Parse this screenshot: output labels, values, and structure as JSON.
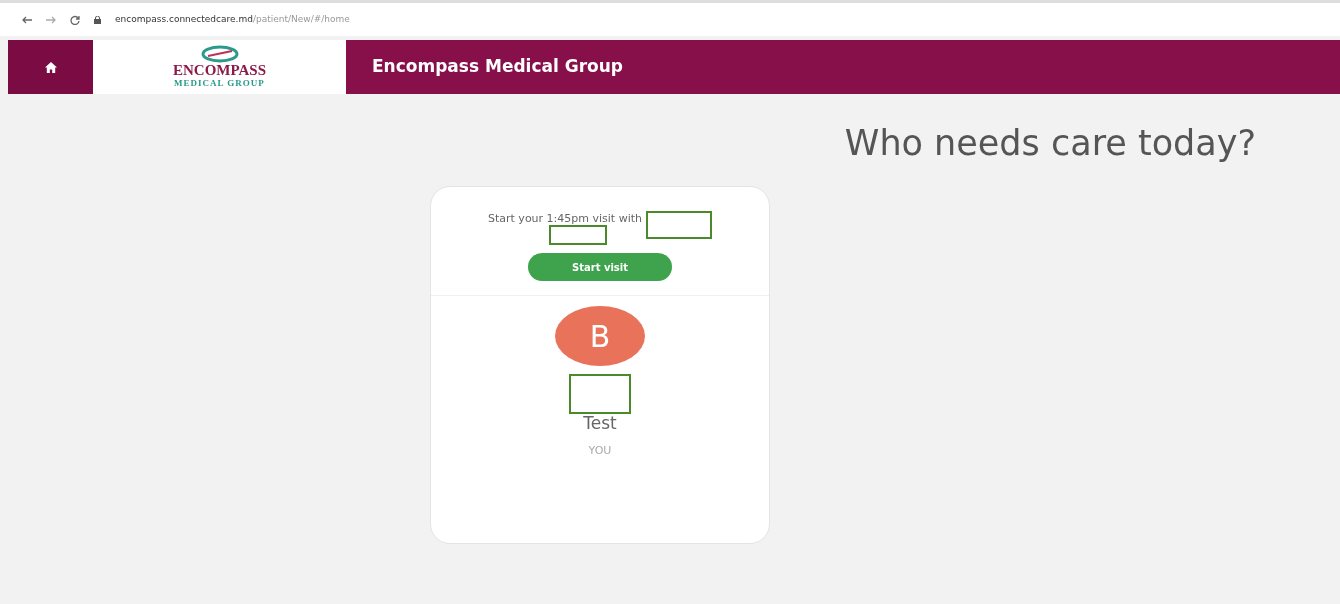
{
  "browser": {
    "url_host": "encompass.connectedcare.md",
    "url_path": "/patient/New/#/home"
  },
  "header": {
    "logo_name": "ENCOMPASS",
    "logo_sub": "MEDICAL GROUP",
    "title": "Encompass Medical Group"
  },
  "heading": "Who needs care today?",
  "card": {
    "prompt": "Start your 1:45pm visit with",
    "button": "Start visit",
    "avatar_letter": "B",
    "name": "Test",
    "relation": "YOU"
  }
}
